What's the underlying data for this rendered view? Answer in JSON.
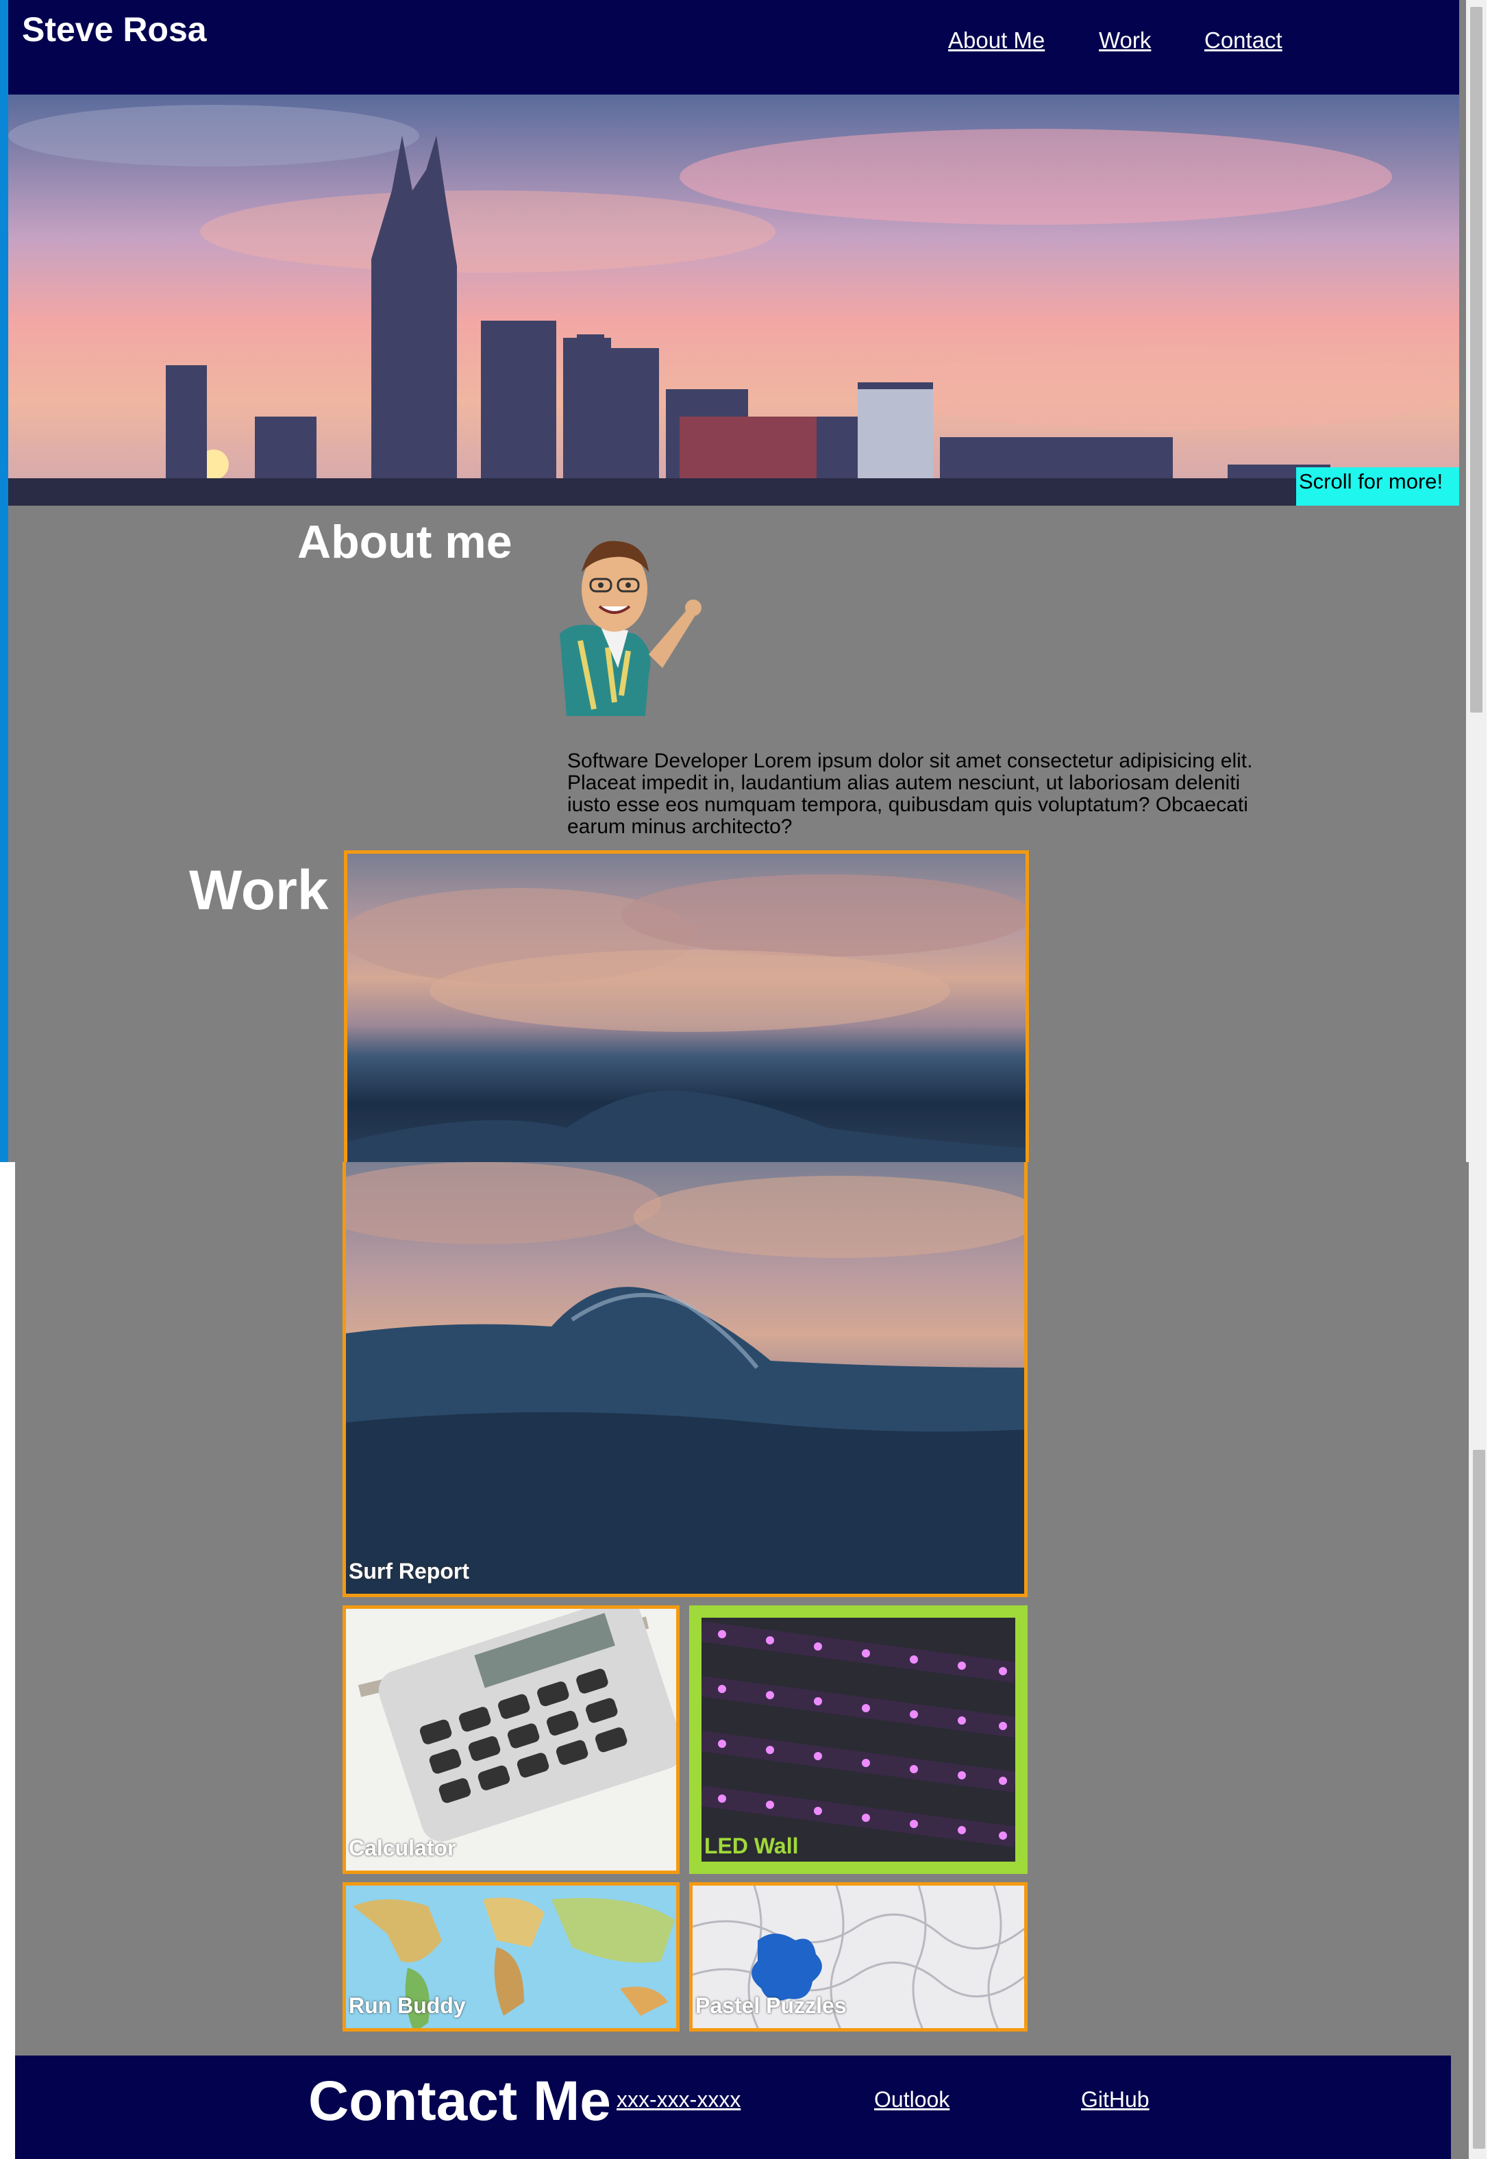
{
  "header": {
    "brand": "Steve Rosa",
    "nav": [
      "About Me",
      "Work",
      "Contact"
    ]
  },
  "hero": {
    "scroll_label": "Scroll for more!"
  },
  "about": {
    "heading": "About me",
    "text": "Software Developer Lorem ipsum dolor sit amet consectetur adipisicing elit. Placeat impedit in, laudantium alias autem nesciunt, ut laboriosam deleniti iusto esse eos numquam tempora, quibusdam quis voluptatum? Obcaecati earum minus architecto?"
  },
  "work": {
    "heading": "Work",
    "projects": [
      "Surf Report",
      "Calculator",
      "LED Wall",
      "Run Buddy",
      "Pastel Puzzles"
    ]
  },
  "contact": {
    "heading": "Contact Me",
    "links": [
      "xxx-xxx-xxxx",
      "Outlook",
      "GitHub"
    ]
  },
  "colors": {
    "header_bg": "#02024f",
    "page_bg": "#808080",
    "card_border": "#f39a12",
    "led_border": "#a0d93a",
    "scroll_tag": "#1ff6ee"
  },
  "icons": [
    "avatar-bitmoji"
  ]
}
